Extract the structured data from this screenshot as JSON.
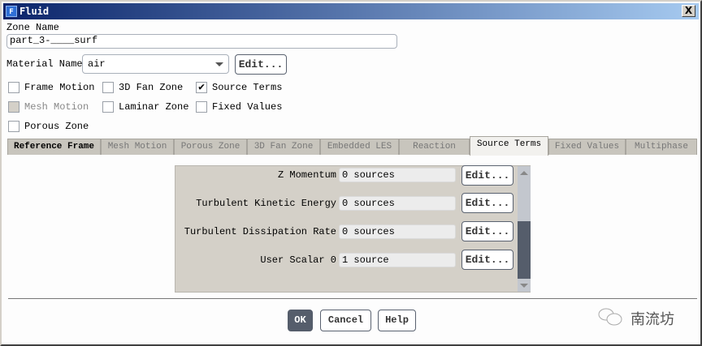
{
  "window": {
    "title": "Fluid",
    "icon": "F",
    "close": "X"
  },
  "zone_name": {
    "label": "Zone Name",
    "value": "part_3-____surf"
  },
  "material": {
    "label": "Material Name",
    "value": "air",
    "edit_label": "Edit..."
  },
  "checkboxes": [
    {
      "label": "Frame Motion",
      "checked": false,
      "disabled": false
    },
    {
      "label": "3D Fan Zone",
      "checked": false,
      "disabled": false
    },
    {
      "label": "Source Terms",
      "checked": true,
      "disabled": false
    },
    {
      "label": "Mesh Motion",
      "checked": false,
      "disabled": true
    },
    {
      "label": "Laminar Zone",
      "checked": false,
      "disabled": false
    },
    {
      "label": "Fixed Values",
      "checked": false,
      "disabled": false
    },
    {
      "label": "Porous Zone",
      "checked": false,
      "disabled": false
    }
  ],
  "tabs": [
    {
      "label": "Reference Frame"
    },
    {
      "label": "Mesh Motion"
    },
    {
      "label": "Porous Zone"
    },
    {
      "label": "3D Fan Zone"
    },
    {
      "label": "Embedded LES"
    },
    {
      "label": "Reaction"
    },
    {
      "label": "Source Terms",
      "active": true
    },
    {
      "label": "Fixed Values"
    },
    {
      "label": "Multiphase"
    }
  ],
  "source_rows": [
    {
      "label": "Z Momentum",
      "value": "0 sources",
      "edit": "Edit..."
    },
    {
      "label": "Turbulent Kinetic Energy",
      "value": "0 sources",
      "edit": "Edit..."
    },
    {
      "label": "Turbulent Dissipation Rate",
      "value": "0 sources",
      "edit": "Edit..."
    },
    {
      "label": "User Scalar 0",
      "value": "1 source",
      "edit": "Edit..."
    }
  ],
  "buttons": {
    "ok": "OK",
    "cancel": "Cancel",
    "help": "Help"
  },
  "watermark": "南流坊",
  "colors": {
    "title_start": "#0a246a",
    "title_end": "#a6caf0",
    "primary_button": "#555d6b"
  }
}
